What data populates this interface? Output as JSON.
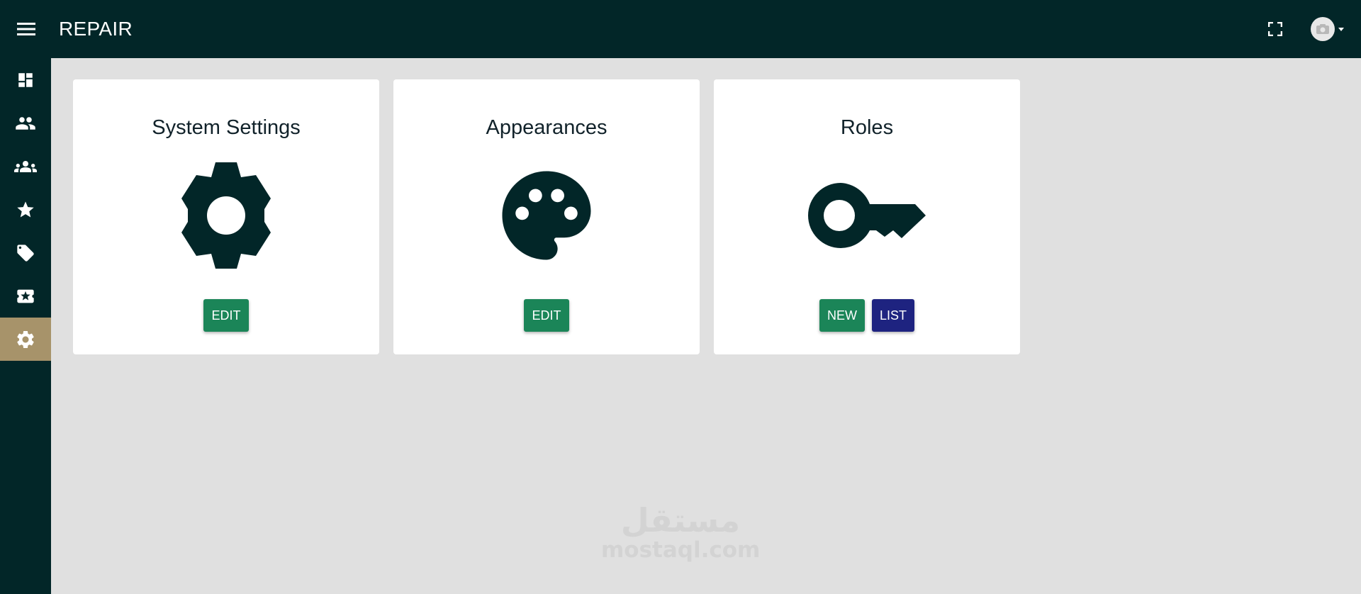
{
  "app": {
    "title": "REPAIR"
  },
  "topbar": {
    "menu_icon": "menu-icon",
    "fullscreen_icon": "fullscreen-icon",
    "avatar_icon": "user-avatar-icon"
  },
  "sidebar": {
    "items": [
      {
        "icon": "dashboard-icon",
        "active": false
      },
      {
        "icon": "people-icon",
        "active": false
      },
      {
        "icon": "groups-icon",
        "active": false
      },
      {
        "icon": "star-icon",
        "active": false
      },
      {
        "icon": "tag-icon",
        "active": false
      },
      {
        "icon": "ticket-star-icon",
        "active": false
      },
      {
        "icon": "settings-gear-icon",
        "active": true
      }
    ]
  },
  "cards": [
    {
      "title": "System Settings",
      "icon": "gear-icon",
      "buttons": [
        {
          "label": "EDIT",
          "color": "#1b8558"
        }
      ]
    },
    {
      "title": "Appearances",
      "icon": "palette-icon",
      "buttons": [
        {
          "label": "EDIT",
          "color": "#1b8558"
        }
      ]
    },
    {
      "title": "Roles",
      "icon": "key-icon",
      "buttons": [
        {
          "label": "NEW",
          "color": "#1b8558"
        },
        {
          "label": "LIST",
          "color": "#1e2380"
        }
      ]
    }
  ],
  "watermark": {
    "arabic": "مستقل",
    "latin": "mostaql.com"
  },
  "colors": {
    "topbar": "#022628",
    "sidebar": "#022628",
    "sidebar_active": "#a7936a",
    "background": "#e0e0e0",
    "card": "#ffffff",
    "icon": "#022628",
    "green_button": "#1b8558",
    "navy_button": "#1e2380"
  }
}
